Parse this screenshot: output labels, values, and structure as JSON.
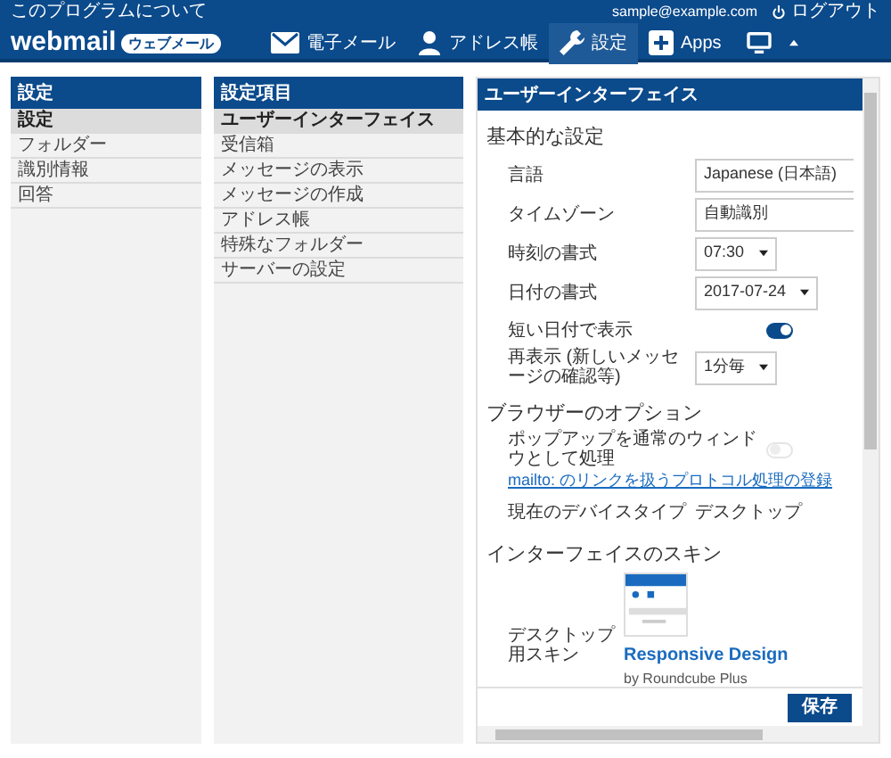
{
  "top_bar": {
    "about": "このプログラムについて",
    "email": "sample@example.com",
    "logout": "ログアウト"
  },
  "logo": {
    "name": "webmail",
    "badge": "ウェブメール"
  },
  "nav": [
    {
      "label": "電子メール",
      "selected": false
    },
    {
      "label": "アドレス帳",
      "selected": false
    },
    {
      "label": "設定",
      "selected": true
    },
    {
      "label": "Apps",
      "selected": false
    }
  ],
  "sections": {
    "title": "設定",
    "items": [
      {
        "label": "設定",
        "selected": true
      },
      {
        "label": "フォルダー",
        "selected": false
      },
      {
        "label": "識別情報",
        "selected": false
      },
      {
        "label": "回答",
        "selected": false
      }
    ]
  },
  "settings_items": {
    "title": "設定項目",
    "items": [
      {
        "label": "ユーザーインターフェイス",
        "selected": true
      },
      {
        "label": "受信箱",
        "selected": false
      },
      {
        "label": "メッセージの表示",
        "selected": false
      },
      {
        "label": "メッセージの作成",
        "selected": false
      },
      {
        "label": "アドレス帳",
        "selected": false
      },
      {
        "label": "特殊なフォルダー",
        "selected": false
      },
      {
        "label": "サーバーの設定",
        "selected": false
      }
    ]
  },
  "panel": {
    "title": "ユーザーインターフェイス",
    "groups": [
      {
        "title": "基本的な設定",
        "rows": [
          {
            "kind": "field",
            "label": "言語",
            "value": "Japanese (日本語)"
          },
          {
            "kind": "field",
            "label": "タイムゾーン",
            "value": "自動識別"
          },
          {
            "kind": "select",
            "label": "時刻の書式",
            "value": "07:30"
          },
          {
            "kind": "select",
            "label": "日付の書式",
            "value": "2017-07-24"
          },
          {
            "kind": "toggle",
            "label": "短い日付で表示",
            "on": true,
            "disabled": false
          },
          {
            "kind": "select",
            "label": "再表示 (新しいメッセージの確認等)",
            "value": "1分毎"
          }
        ]
      },
      {
        "title": "ブラウザーのオプション",
        "rows": [
          {
            "kind": "toggle",
            "label": "ポップアップを通常のウィンドウとして処理",
            "on": false,
            "disabled": true
          },
          {
            "kind": "link",
            "label": "mailto: のリンクを扱うプロトコル処理の登録"
          },
          {
            "kind": "text",
            "label": "現在のデバイスタイプ",
            "value": "デスクトップ"
          }
        ]
      },
      {
        "title": "インターフェイスのスキン",
        "rows": [
          {
            "kind": "skin",
            "label": "デスクトップ用スキン",
            "name": "Responsive Design",
            "author": "by Roundcube Plus"
          }
        ]
      }
    ],
    "save": "保存"
  }
}
